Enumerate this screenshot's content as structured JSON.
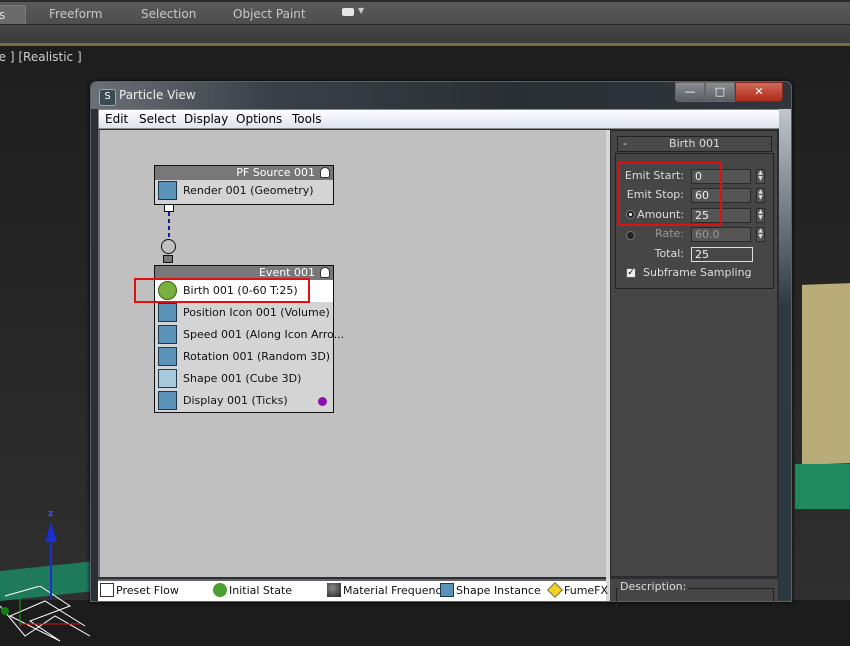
{
  "ribbon": {
    "tabs": [
      {
        "label": "s",
        "active": true
      },
      {
        "label": "Freeform",
        "active": false
      },
      {
        "label": "Selection",
        "active": false
      },
      {
        "label": "Object Paint",
        "active": false
      }
    ],
    "extra_dropdown_icon": "ribbon-options-icon"
  },
  "viewport": {
    "label": "re ] [Realistic ]",
    "axis_label": "z"
  },
  "particle_view": {
    "title": "Particle View",
    "window_buttons": {
      "minimize": "—",
      "maximize": "□",
      "close": "✕"
    },
    "menu": [
      "Edit",
      "Select",
      "Display",
      "Options",
      "Tools"
    ],
    "source_node": {
      "title": "PF Source 001",
      "operators": [
        {
          "label": "Render 001 (Geometry)",
          "icon": "render-icon"
        }
      ]
    },
    "event_node": {
      "title": "Event 001",
      "operators": [
        {
          "label": "Birth 001 (0-60 T:25)",
          "icon": "birth-icon",
          "selected": true
        },
        {
          "label": "Position Icon 001 (Volume)",
          "icon": "position-icon"
        },
        {
          "label": "Speed 001 (Along Icon Arro...",
          "icon": "speed-icon"
        },
        {
          "label": "Rotation 001 (Random 3D)",
          "icon": "rotation-icon"
        },
        {
          "label": "Shape 001 (Cube 3D)",
          "icon": "shape-icon"
        },
        {
          "label": "Display 001 (Ticks)",
          "icon": "display-icon",
          "color": "#8a10b0"
        }
      ]
    },
    "birth_panel": {
      "rollout_title": "Birth 001",
      "collapse_symbol": "-",
      "emit_start_label": "Emit Start:",
      "emit_start_value": "0",
      "emit_stop_label": "Emit Stop:",
      "emit_stop_value": "60",
      "amount_label": "Amount:",
      "amount_value": "25",
      "amount_selected": true,
      "rate_label": "Rate:",
      "rate_value": "60.0",
      "total_label": "Total:",
      "total_value": "25",
      "subframe_label": "Subframe Sampling",
      "subframe_checked": true
    },
    "description_label": "Description:",
    "depot": [
      {
        "label": "Preset Flow",
        "icon": "preset-flow-icon"
      },
      {
        "label": "Initial State",
        "icon": "initial-state-icon"
      },
      {
        "label": "Material Frequency",
        "icon": "material-frequency-icon"
      },
      {
        "label": "Shape Instance",
        "icon": "shape-instance-icon"
      },
      {
        "label": "FumeFX",
        "icon": "fumefx-icon"
      }
    ],
    "highlight_color": "#e01010"
  }
}
